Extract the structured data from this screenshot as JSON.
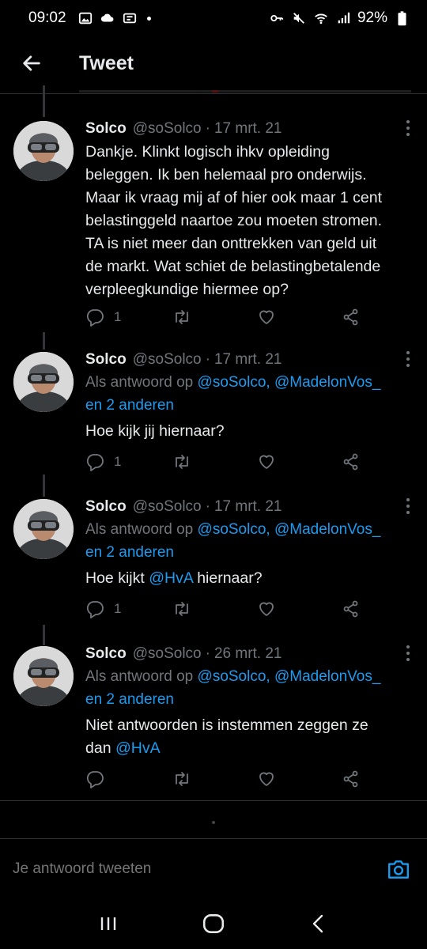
{
  "status_bar": {
    "time": "09:02",
    "battery": "92%"
  },
  "header": {
    "title": "Tweet"
  },
  "tweets": [
    {
      "name": "Solco",
      "handle": "@soSolco",
      "sep": "·",
      "date": "17 mrt. 21",
      "lines": [
        "Dankje. Klinkt logisch ihkv opleiding",
        "beleggen. Ik ben helemaal pro onderwijs.",
        "Maar ik vraag mij af of hier ook maar 1 cent",
        "belastinggeld naartoe zou moeten stromen.",
        "TA is niet meer dan onttrekken van geld uit",
        "de markt. Wat schiet de belastingbetalende",
        "verpleegkundige hiermee op?"
      ],
      "reply_count": "1"
    },
    {
      "name": "Solco",
      "handle": "@soSolco",
      "sep": "·",
      "date": "17 mrt. 21",
      "reply_prefix": "Als antwoord op",
      "reply_mentions": "@soSolco, @MadelonVos_",
      "reply_others": "en 2 anderen",
      "text": "Hoe kijk jij hiernaar?",
      "reply_count": "1"
    },
    {
      "name": "Solco",
      "handle": "@soSolco",
      "sep": "·",
      "date": "17 mrt. 21",
      "reply_prefix": "Als antwoord op",
      "reply_mentions": "@soSolco, @MadelonVos_",
      "reply_others": "en 2 anderen",
      "text_before": "Hoe kijkt",
      "text_mention": "@HvA",
      "text_after": "hiernaar?",
      "reply_count": "1"
    },
    {
      "name": "Solco",
      "handle": "@soSolco",
      "sep": "·",
      "date": "26 mrt. 21",
      "reply_prefix": "Als antwoord op",
      "reply_mentions": "@soSolco, @MadelonVos_",
      "reply_others": "en 2 anderen",
      "text_line1": "Niet antwoorden is instemmen zeggen ze",
      "text_line2_before": "dan",
      "text_mention": "@HvA",
      "reply_count": ""
    }
  ],
  "composer": {
    "placeholder": "Je antwoord tweeten"
  },
  "colors": {
    "accent": "#1d9bf0",
    "muted": "#71767b",
    "background": "#000000"
  },
  "icons": [
    "arrow-left-icon",
    "reply-icon",
    "retweet-icon",
    "heart-icon",
    "share-icon",
    "more-vertical-icon",
    "camera-icon"
  ]
}
